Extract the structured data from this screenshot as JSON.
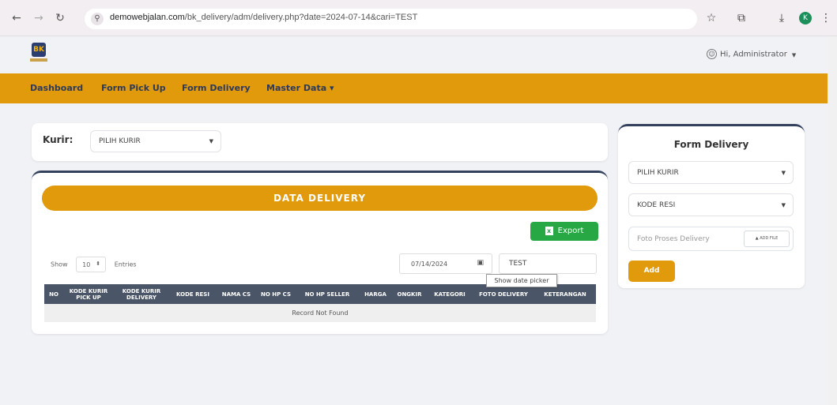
{
  "browser": {
    "url_host": "demowebjalan.com",
    "url_path": "/bk_delivery/adm/delivery.php?date=2024-07-14&cari=TEST",
    "profile_initial": "K"
  },
  "header": {
    "logo_text": "BK",
    "user_greeting": "Hi, Administrator"
  },
  "nav": {
    "items": [
      "Dashboard",
      "Form Pick Up",
      "Form Delivery",
      "Master Data ▾"
    ]
  },
  "filter": {
    "kurir_label": "Kurir:",
    "kurir_select": "PILIH KURIR"
  },
  "data_delivery": {
    "title": "DATA DELIVERY",
    "export_label": "Export",
    "show_label": "Show",
    "entries_value": "10",
    "entries_label": "Entries",
    "date_value": "07/14/2024",
    "search_value": "TEST",
    "tooltip": "Show date picker",
    "columns": [
      "NO",
      "KODE KURIR PICK UP",
      "KODE KURIR DELIVERY",
      "KODE RESI",
      "NAMA CS",
      "NO HP CS",
      "NO HP SELLER",
      "HARGA",
      "ONGKIR",
      "KATEGORI",
      "FOTO DELIVERY",
      "KETERANGAN"
    ],
    "empty_message": "Record Not Found"
  },
  "form_delivery": {
    "title": "Form Delivery",
    "kurir_select": "PILIH KURIR",
    "resi_select": "KODE RESI",
    "photo_placeholder": "Foto Proses Delivery",
    "photo_button": "ADD FILE",
    "add_label": "Add"
  },
  "colors": {
    "accent": "#e09a0c",
    "navy": "#33415c",
    "export_green": "#28a745"
  }
}
